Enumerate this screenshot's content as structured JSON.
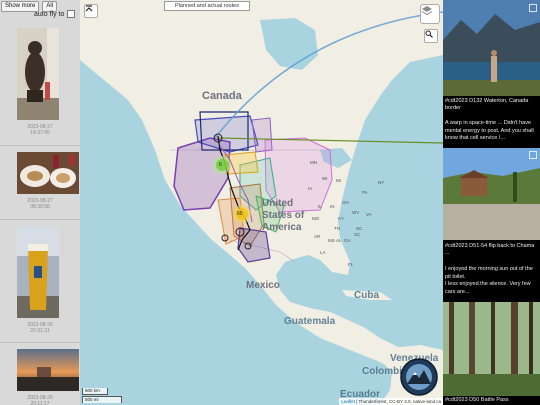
{
  "controls": {
    "show_more": "Show more",
    "all": "All",
    "auto_fly": "auto fly to"
  },
  "thumbnails": [
    {
      "timestamp": "2023-08-27\n14:37:45"
    },
    {
      "timestamp": "2023-08-27\n08:39:58"
    },
    {
      "timestamp": "2023-08-26\n20:31:31"
    },
    {
      "timestamp": "2023-08-26\n20:11:17"
    }
  ],
  "map": {
    "title": "Planned and actual routes",
    "labels": {
      "canada": "Canada",
      "united_states": "United States of America",
      "mexico": "Mexico",
      "cuba": "Cuba",
      "guatemala": "Guatemala",
      "venezuela": "Venezuela",
      "colombia": "Colombia",
      "ecuador": "Ecuador"
    },
    "states": [
      "MN",
      "IL",
      "IN",
      "OH",
      "PA",
      "NY",
      "WV",
      "VA",
      "KY",
      "TN",
      "NC",
      "MS",
      "AL",
      "GA",
      "SC",
      "FL",
      "MO",
      "AR",
      "LA",
      "IA",
      "WI",
      "MI"
    ],
    "cluster_counts": [
      "6",
      "60"
    ],
    "scale_km": "500 km",
    "scale_mi": "500 mi",
    "attribution_leaflet": "Leaflet",
    "attribution_rest": "| Thunderforest, CC-BY 3.0, native-land.ca"
  },
  "posts": [
    {
      "title": "#cdt2023 D132 Waterton, Canada border",
      "text": "A warp in space-time ... Didn't have mental energy to post. And you shall know that cell service /..."
    },
    {
      "title": "#cdt2023 D51-54 flip back to Chama ...",
      "text": "I enjoyed the morning sun out of the pit toilet.\nI less enjoyed the silence. Very few cars are..."
    },
    {
      "title": "#cdt2023 D50 Battle Pass"
    }
  ],
  "colors": {
    "water": "#a9d3df",
    "land": "#f1eee4",
    "accent_route": "#6b8e23",
    "flight_arc": "#5f9fd7"
  }
}
